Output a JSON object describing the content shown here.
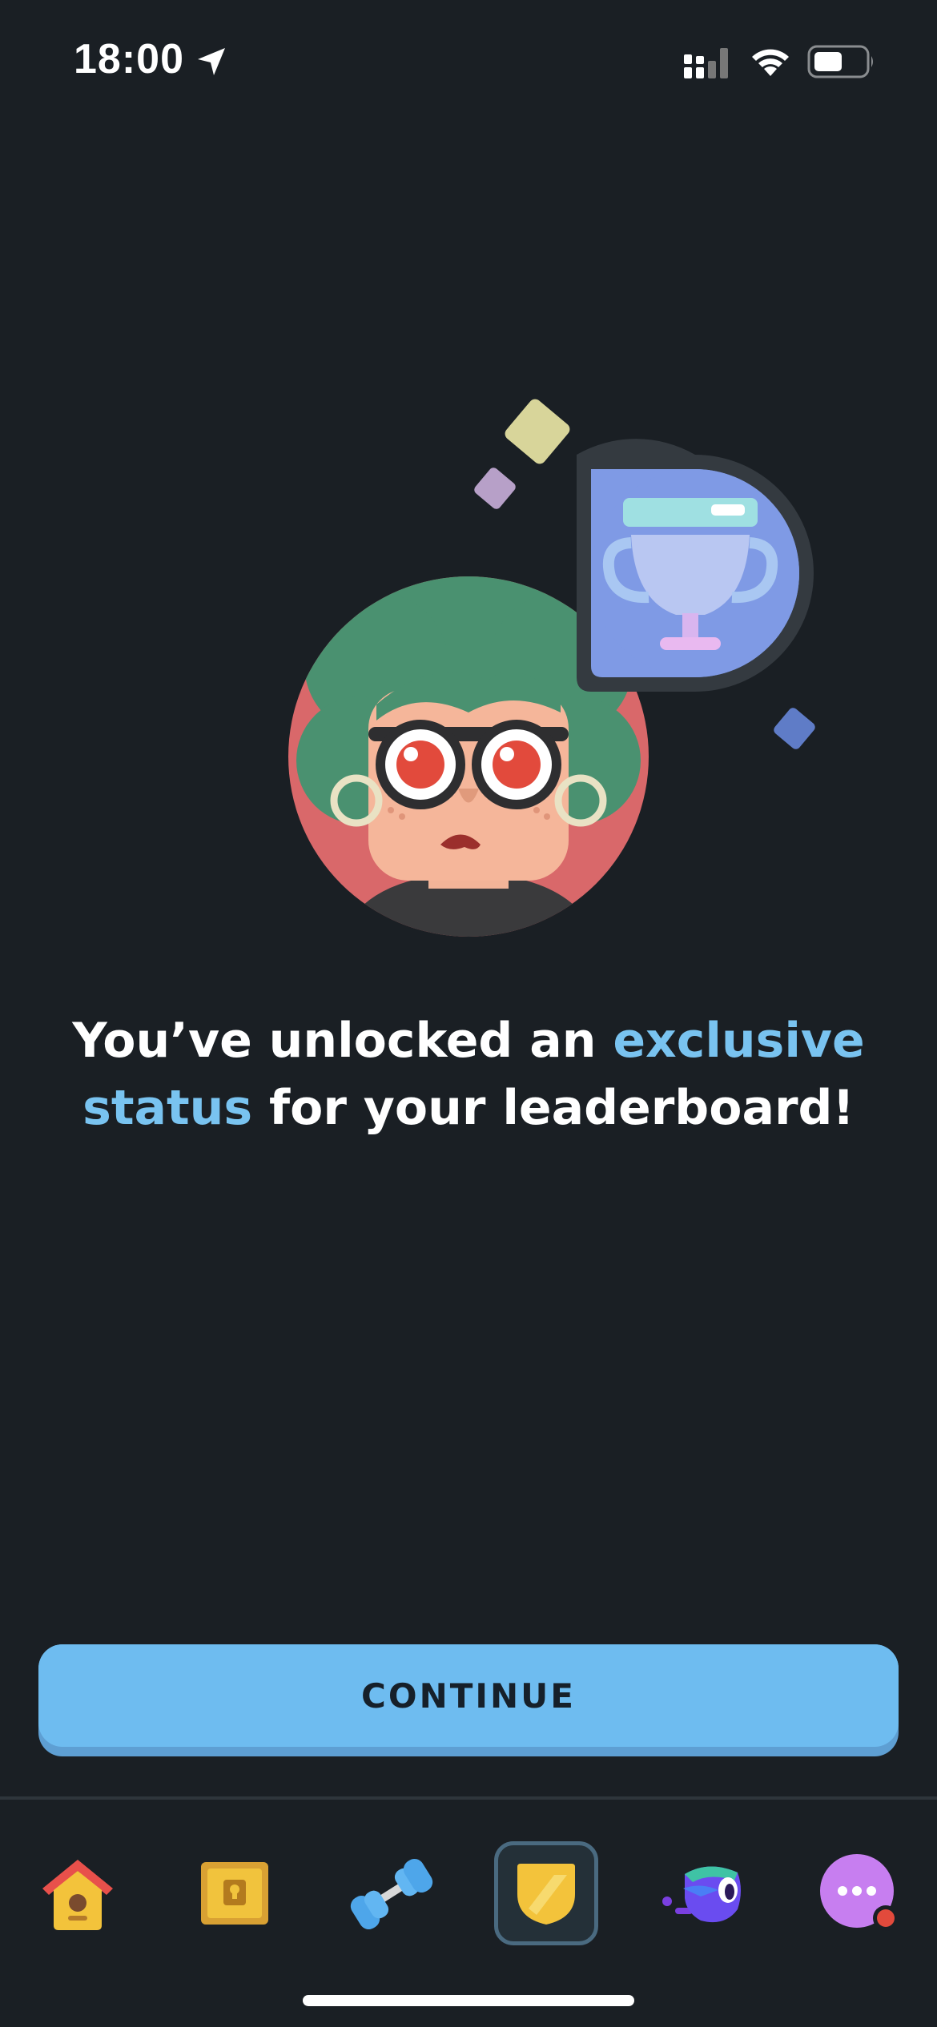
{
  "status_bar": {
    "time": "18:00"
  },
  "headline": {
    "part1": "You’ve unlocked an ",
    "highlight1": "exclusive",
    "newline_highlight": "status",
    "part2": " for your leaderboard!"
  },
  "continue_button": {
    "label": "CONTINUE"
  },
  "colors": {
    "background": "#1a1f24",
    "accent": "#79c3f0",
    "button": "#6ebcf0",
    "button_shadow": "#5e9fd3",
    "avatar_bg": "#d9686a",
    "hair": "#4a9170",
    "badge_bg": "#7f9ae5"
  },
  "tabs": [
    {
      "name": "home",
      "icon": "house-icon",
      "active": false
    },
    {
      "name": "treasure",
      "icon": "treasure-chest-icon",
      "active": false
    },
    {
      "name": "practice",
      "icon": "dumbbell-icon",
      "active": false
    },
    {
      "name": "leaderboard",
      "icon": "shield-icon",
      "active": true
    },
    {
      "name": "characters",
      "icon": "character-icon",
      "active": false
    },
    {
      "name": "more",
      "icon": "more-icon",
      "active": false
    }
  ]
}
